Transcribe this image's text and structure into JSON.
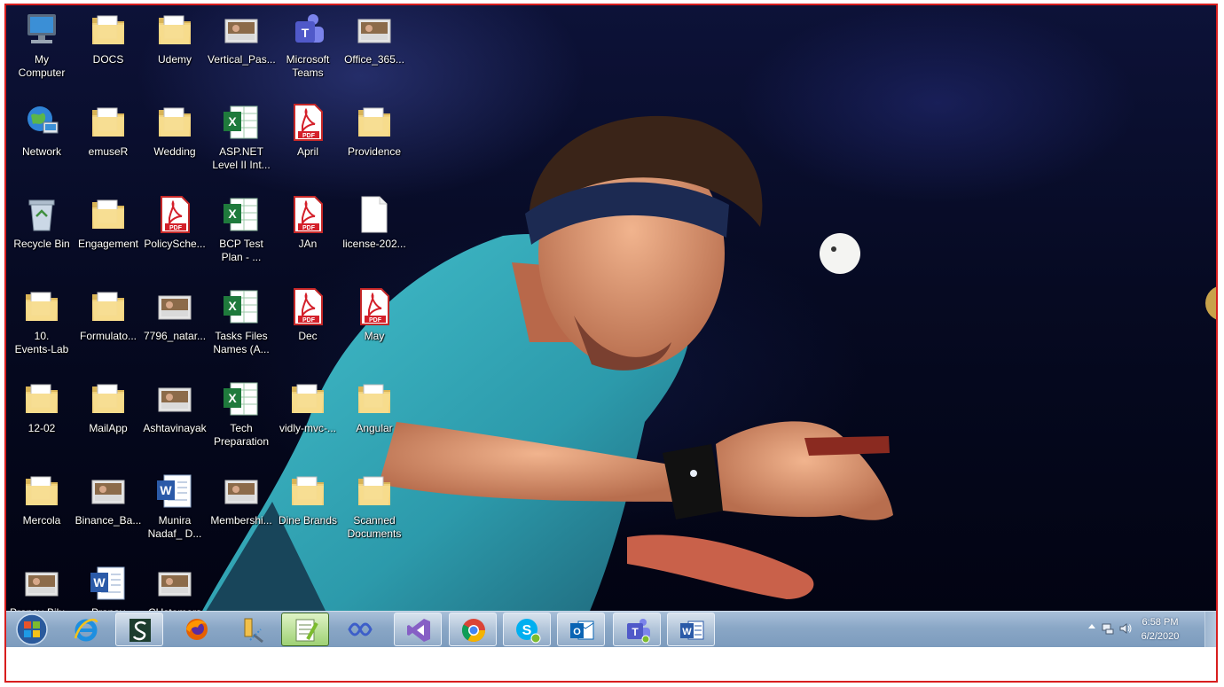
{
  "desktop": {
    "icons": [
      {
        "label": "My\nComputer",
        "icon": "computer-icon"
      },
      {
        "label": "DOCS",
        "icon": "folder-icon"
      },
      {
        "label": "Udemy",
        "icon": "folder-icon"
      },
      {
        "label": "Vertical_Pas...",
        "icon": "image-thumbnail-icon"
      },
      {
        "label": "Microsoft\nTeams",
        "icon": "teams-icon"
      },
      {
        "label": "Office_365...",
        "icon": "image-thumbnail-icon"
      },
      {
        "label": "Network",
        "icon": "network-globe-icon"
      },
      {
        "label": "emuseR",
        "icon": "folder-icon"
      },
      {
        "label": "Wedding",
        "icon": "folder-icon"
      },
      {
        "label": "ASP.NET\nLevel II Int...",
        "icon": "excel-icon"
      },
      {
        "label": "April",
        "icon": "pdf-icon"
      },
      {
        "label": "Providence",
        "icon": "folder-icon"
      },
      {
        "label": "Recycle Bin",
        "icon": "recycle-bin-icon"
      },
      {
        "label": "Engagement",
        "icon": "folder-icon"
      },
      {
        "label": "PolicySche...",
        "icon": "pdf-icon"
      },
      {
        "label": "BCP Test\nPlan - ...",
        "icon": "excel-icon"
      },
      {
        "label": "JAn",
        "icon": "pdf-icon"
      },
      {
        "label": "license-202...",
        "icon": "blank-file-icon"
      },
      {
        "label": "10.\nEvents-Lab",
        "icon": "folder-icon"
      },
      {
        "label": "Formulato...",
        "icon": "folder-icon"
      },
      {
        "label": "7796_natar...",
        "icon": "image-thumbnail-icon"
      },
      {
        "label": "Tasks Files\nNames (A...",
        "icon": "excel-icon"
      },
      {
        "label": "Dec",
        "icon": "pdf-icon"
      },
      {
        "label": "May",
        "icon": "pdf-icon"
      },
      {
        "label": "12-02",
        "icon": "folder-icon"
      },
      {
        "label": "MailApp",
        "icon": "folder-icon"
      },
      {
        "label": "Ashtavinayak",
        "icon": "image-thumbnail-icon"
      },
      {
        "label": "Tech\nPreparation",
        "icon": "excel-icon"
      },
      {
        "label": "vidly-mvc-...",
        "icon": "folder-icon"
      },
      {
        "label": "Angular",
        "icon": "folder-icon"
      },
      {
        "label": "Mercola",
        "icon": "folder-icon"
      },
      {
        "label": "Binance_Ba...",
        "icon": "image-thumbnail-icon"
      },
      {
        "label": "Munira\nNadaf_ D...",
        "icon": "word-icon"
      },
      {
        "label": "Membershi...",
        "icon": "image-thumbnail-icon"
      },
      {
        "label": "Dine Brands",
        "icon": "folder-icon"
      },
      {
        "label": "Scanned\nDocuments",
        "icon": "folder-icon"
      },
      {
        "label": "Pranav-Bilu...",
        "icon": "image-thumbnail-icon"
      },
      {
        "label": "Pranav\nBilurkar",
        "icon": "word-icon"
      },
      {
        "label": "CUstomers",
        "icon": "image-thumbnail-icon"
      }
    ]
  },
  "taskbar": {
    "start_icon": "windows-start-orb-icon",
    "pinned": [
      {
        "icon": "internet-explorer-icon",
        "open": false
      },
      {
        "icon": "sql-server-icon",
        "open": true
      },
      {
        "icon": "firefox-icon",
        "open": false
      },
      {
        "icon": "tools-icon",
        "open": false
      },
      {
        "icon": "notepad-plus-plus-icon",
        "open": true,
        "active": true
      },
      {
        "icon": "visual-studio-icon",
        "open": false
      },
      {
        "icon": "visual-studio-purple-icon",
        "open": true
      },
      {
        "icon": "chrome-icon",
        "open": true
      },
      {
        "icon": "skype-icon",
        "open": true
      },
      {
        "icon": "outlook-icon",
        "open": true
      },
      {
        "icon": "teams-icon",
        "open": true
      },
      {
        "icon": "word-icon",
        "open": true
      }
    ],
    "tray": {
      "time": "6:58 PM",
      "date": "6/2/2020",
      "icons": [
        "show-hidden-icons-arrow-icon",
        "network-status-icon",
        "volume-icon"
      ]
    }
  },
  "colors": {
    "frame_border": "#d81e1e",
    "taskbar": "#8aa7c6",
    "folder": "#f2d27b",
    "pdf": "#d4202a",
    "excel": "#1f7a3c",
    "word": "#2b5aa8"
  }
}
